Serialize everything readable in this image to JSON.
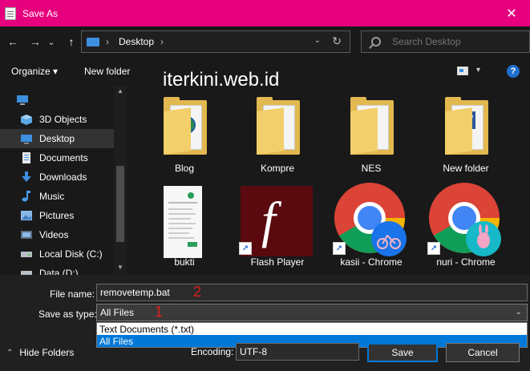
{
  "window": {
    "title": "Save As",
    "close_glyph": "✕"
  },
  "nav": {
    "back_glyph": "←",
    "forward_glyph": "→",
    "recent_glyph": "⌄",
    "up_glyph": "↑",
    "address": {
      "separator": "›",
      "location": "Desktop",
      "dropdown_glyph": "⌄",
      "refresh_glyph": "↻"
    },
    "search_placeholder": "Search Desktop"
  },
  "toolbar": {
    "organize": "Organize ▾",
    "new_folder": "New folder",
    "view_dropdown": "▾",
    "help": "?"
  },
  "watermark": "iterkini.web.id",
  "sidebar": {
    "items": [
      {
        "label": "3D Objects",
        "icon": "3d-objects-icon"
      },
      {
        "label": "Desktop",
        "icon": "desktop-icon",
        "selected": true
      },
      {
        "label": "Documents",
        "icon": "documents-icon"
      },
      {
        "label": "Downloads",
        "icon": "downloads-icon"
      },
      {
        "label": "Music",
        "icon": "music-icon"
      },
      {
        "label": "Pictures",
        "icon": "pictures-icon"
      },
      {
        "label": "Videos",
        "icon": "videos-icon"
      },
      {
        "label": "Local Disk (C:)",
        "icon": "drive-icon"
      },
      {
        "label": "Data (D:)",
        "icon": "drive-icon"
      }
    ],
    "scroll_up": "▲",
    "scroll_down": "▼"
  },
  "files": [
    {
      "label": "Blog",
      "kind": "folder"
    },
    {
      "label": "Kompre",
      "kind": "folder"
    },
    {
      "label": "NES",
      "kind": "folder"
    },
    {
      "label": "New folder",
      "kind": "folder"
    },
    {
      "label": "bukti",
      "kind": "image"
    },
    {
      "label": "Flash Player",
      "kind": "shortcut",
      "glyph": "f"
    },
    {
      "label": "kasii - Chrome",
      "kind": "shortcut"
    },
    {
      "label": "nuri - Chrome",
      "kind": "shortcut"
    }
  ],
  "form": {
    "file_name_label": "File name:",
    "file_name_value": "removetemp.bat",
    "save_as_type_label": "Save as type:",
    "save_as_type_value": "All Files",
    "type_options": [
      "Text Documents (*.txt)",
      "All Files"
    ],
    "annotation_1": "1",
    "annotation_2": "2",
    "encoding_label": "Encoding:",
    "encoding_value": "UTF-8",
    "hide_folders": "Hide Folders",
    "save": "Save",
    "cancel": "Cancel"
  },
  "colors": {
    "title_bar": "#e6007e",
    "selection": "#0078d7",
    "folder": "#e3b84f"
  }
}
